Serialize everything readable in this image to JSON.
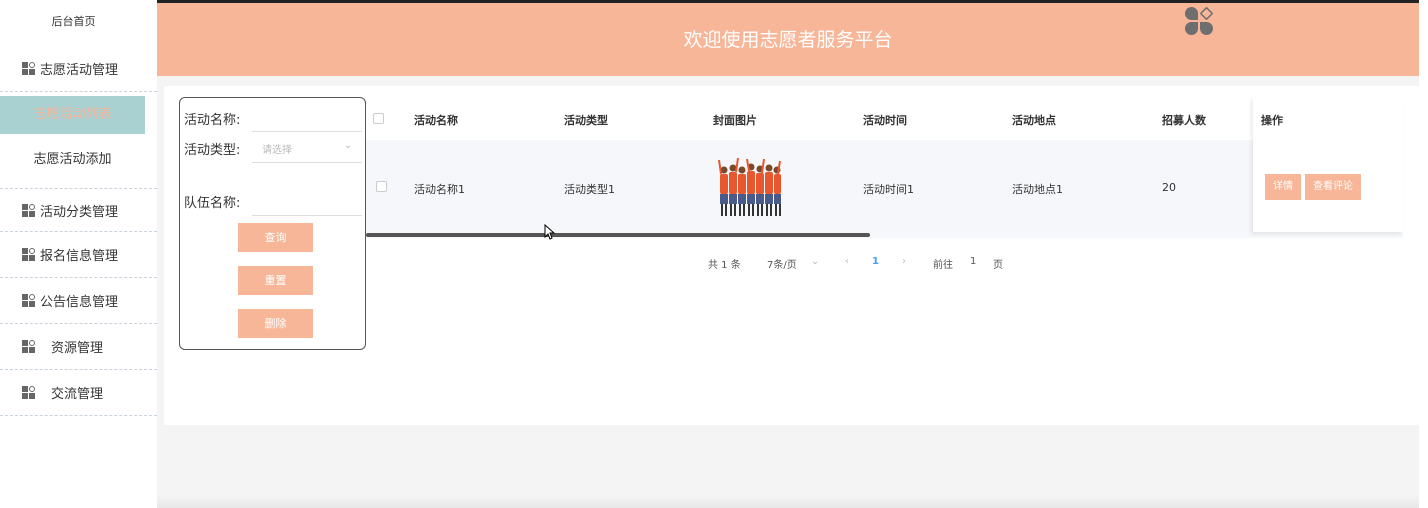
{
  "sidebar": {
    "home": "后台首页",
    "groups": [
      {
        "label": "志愿活动管理",
        "icon": "grid-icon"
      },
      {
        "label": "活动分类管理",
        "icon": "grid-icon"
      },
      {
        "label": "报名信息管理",
        "icon": "grid-icon"
      },
      {
        "label": "公告信息管理",
        "icon": "grid-icon"
      },
      {
        "label": "资源管理",
        "icon": "grid-icon"
      },
      {
        "label": "交流管理",
        "icon": "grid-icon"
      }
    ],
    "subitems": [
      {
        "label": "志愿活动列表",
        "active": true
      },
      {
        "label": "志愿活动添加",
        "active": false
      }
    ]
  },
  "header": {
    "title": "欢迎使用志愿者服务平台",
    "avatar_icon": "user-avatar-icon"
  },
  "search": {
    "activity_name_label": "活动名称:",
    "activity_type_label": "活动类型:",
    "activity_type_placeholder": "请选择",
    "team_name_label": "队伍名称:",
    "query_button": "查询",
    "reset_button": "重置",
    "delete_button": "删除"
  },
  "table": {
    "headers": [
      "活动名称",
      "活动类型",
      "封面图片",
      "活动时间",
      "活动地点",
      "招募人数",
      "操作"
    ],
    "rows": [
      {
        "name": "活动名称1",
        "type": "活动类型1",
        "cover": "volunteers-image",
        "time": "活动时间1",
        "place": "活动地点1",
        "count": "20",
        "actions": [
          "详情",
          "查看评论"
        ]
      }
    ]
  },
  "pagination": {
    "total": "共 1 条",
    "page_size": "7条/页",
    "current": "1",
    "goto_label": "前往",
    "goto_value": "1",
    "page_suffix": "页"
  },
  "colors": {
    "accent": "#f7b698",
    "active_bg": "#a9d1d2",
    "link": "#409eff"
  }
}
